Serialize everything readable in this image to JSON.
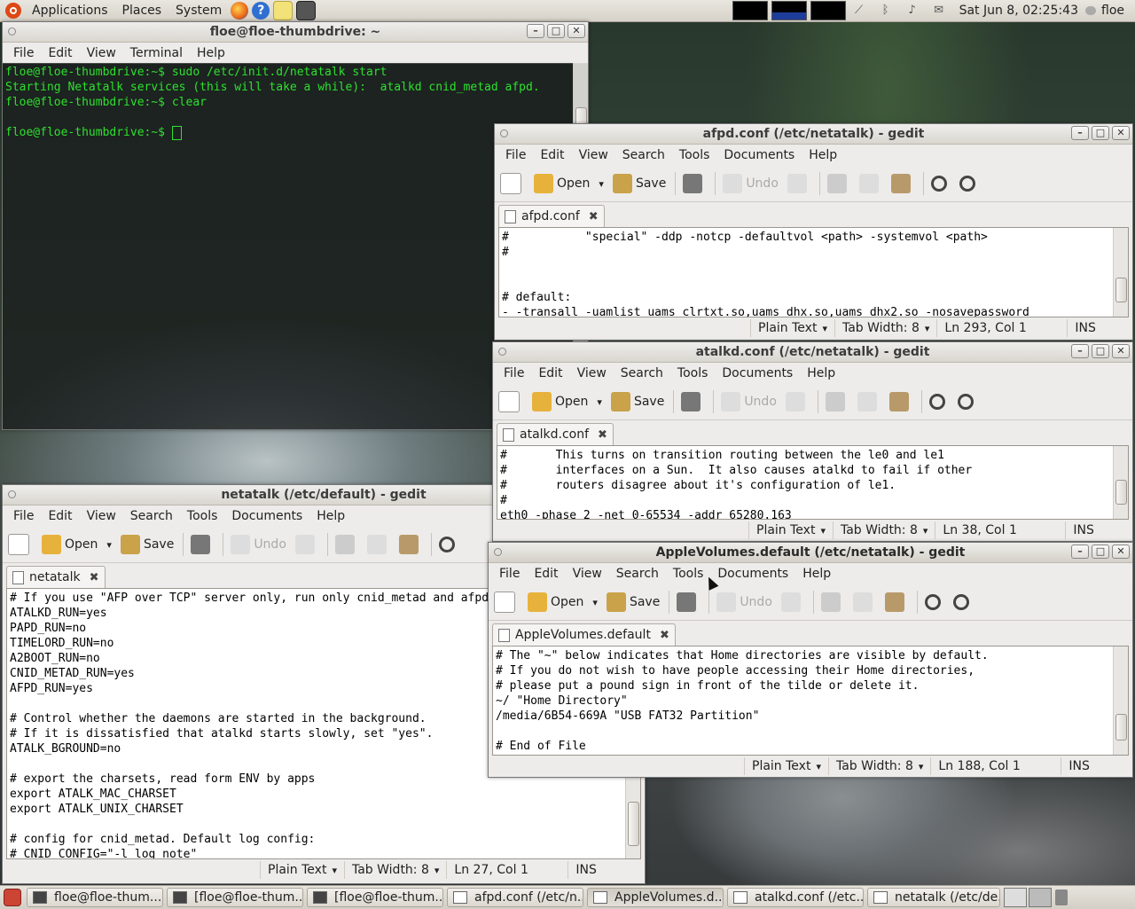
{
  "top_panel": {
    "menus": [
      "Applications",
      "Places",
      "System"
    ],
    "clock": "Sat Jun  8, 02:25:43",
    "user": "floe"
  },
  "terminal": {
    "title": "floe@floe-thumbdrive: ~",
    "menu": [
      "File",
      "Edit",
      "View",
      "Terminal",
      "Help"
    ],
    "lines": [
      "floe@floe-thumbdrive:~$ sudo /etc/init.d/netatalk start",
      "Starting Netatalk services (this will take a while):  atalkd cnid_metad afpd.",
      "floe@floe-thumbdrive:~$ clear",
      "",
      "floe@floe-thumbdrive:~$ "
    ]
  },
  "gedit_common": {
    "menu": [
      "File",
      "Edit",
      "View",
      "Search",
      "Tools",
      "Documents",
      "Help"
    ],
    "open": "Open",
    "save": "Save",
    "undo": "Undo",
    "lang": "Plain Text",
    "tabwidth": "Tab Width: 8",
    "ins": "INS"
  },
  "afpd": {
    "title": "afpd.conf (/etc/netatalk) - gedit",
    "tab": "afpd.conf",
    "pos": "Ln 293, Col 1",
    "lines": [
      "#           \"special\" -ddp -notcp -defaultvol <path> -systemvol <path>",
      "#",
      "",
      "",
      "# default:",
      "- -transall -uamlist uams_clrtxt.so,uams_dhx.so,uams_dhx2.so -nosavepassword"
    ]
  },
  "atalkd": {
    "title": "atalkd.conf (/etc/netatalk) - gedit",
    "tab": "atalkd.conf",
    "pos": "Ln 38, Col 1",
    "lines": [
      "#       This turns on transition routing between the le0 and le1",
      "#       interfaces on a Sun.  It also causes atalkd to fail if other",
      "#       routers disagree about it's configuration of le1.",
      "#",
      "eth0 -phase 2 -net 0-65534 -addr 65280.163"
    ]
  },
  "netatalk": {
    "title": "netatalk (/etc/default) - gedit",
    "tab": "netatalk",
    "pos": "Ln 27, Col 1",
    "lines": [
      "# If you use \"AFP over TCP\" server only, run only cnid_metad and afpd.",
      "ATALKD_RUN=yes",
      "PAPD_RUN=no",
      "TIMELORD_RUN=no",
      "A2BOOT_RUN=no",
      "CNID_METAD_RUN=yes",
      "AFPD_RUN=yes",
      "",
      "# Control whether the daemons are started in the background.",
      "# If it is dissatisfied that atalkd starts slowly, set \"yes\".",
      "ATALK_BGROUND=no",
      "",
      "# export the charsets, read form ENV by apps",
      "export ATALK_MAC_CHARSET",
      "export ATALK_UNIX_CHARSET",
      "",
      "# config for cnid_metad. Default log config:",
      "# CNID_CONFIG=\"-l log_note\""
    ]
  },
  "applevolumes": {
    "title": "AppleVolumes.default (/etc/netatalk) - gedit",
    "tab": "AppleVolumes.default",
    "pos": "Ln 188, Col 1",
    "lines": [
      "# The \"~\" below indicates that Home directories are visible by default.",
      "# If you do not wish to have people accessing their Home directories,",
      "# please put a pound sign in front of the tilde or delete it.",
      "~/ \"Home Directory\"",
      "/media/6B54-669A \"USB FAT32 Partition\"",
      "",
      "# End of File"
    ]
  },
  "taskbar": [
    "floe@floe-thum...",
    "[floe@floe-thum...",
    "[floe@floe-thum...",
    "afpd.conf (/etc/n...",
    "AppleVolumes.d...",
    "atalkd.conf (/etc...",
    "netatalk (/etc/de..."
  ]
}
